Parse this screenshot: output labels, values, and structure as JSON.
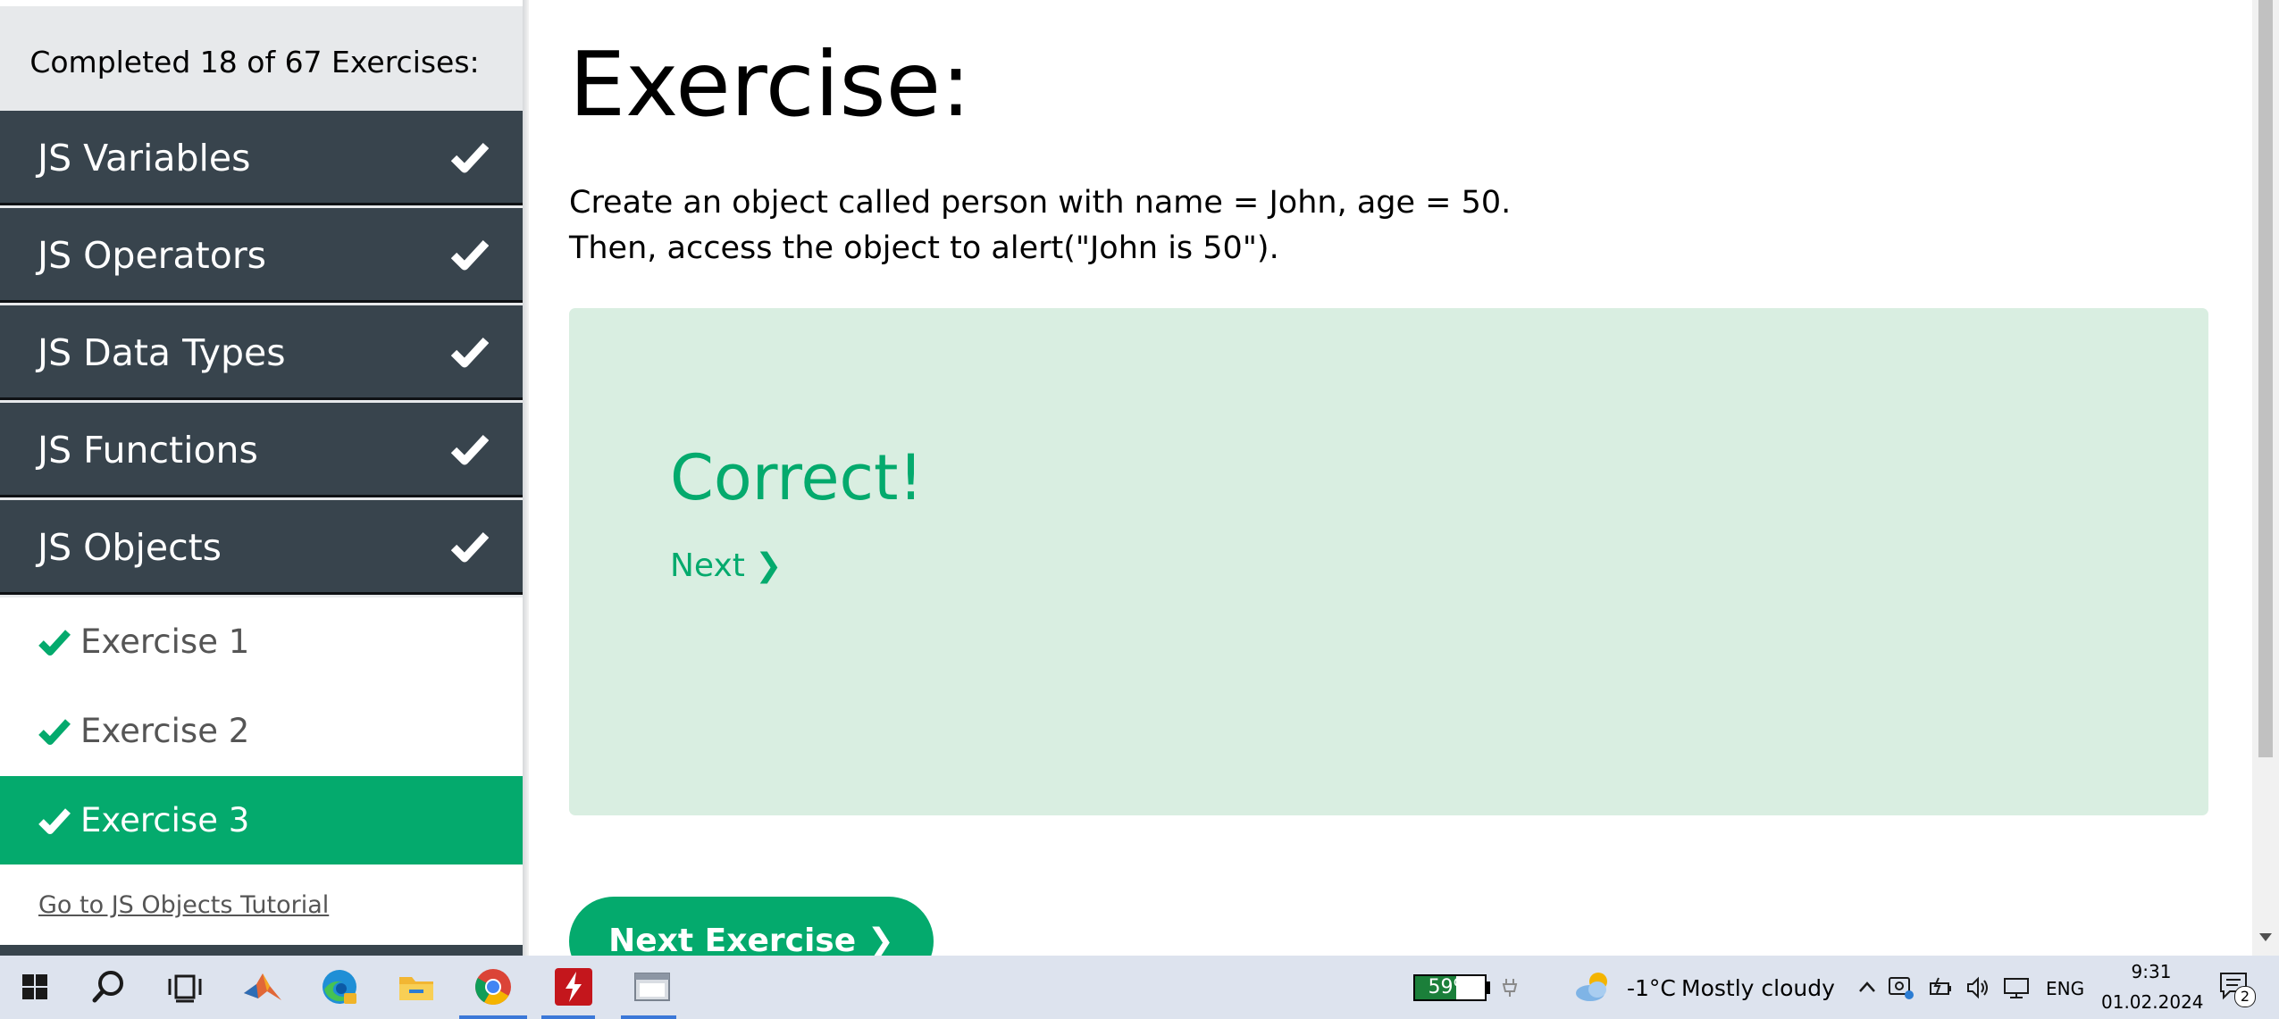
{
  "sidebar": {
    "progress_text": "Completed 18 of 67 Exercises:",
    "categories": [
      {
        "label": "JS Variables"
      },
      {
        "label": "JS Operators"
      },
      {
        "label": "JS Data Types"
      },
      {
        "label": "JS Functions"
      },
      {
        "label": "JS Objects"
      }
    ],
    "exercises": [
      {
        "label": "Exercise 1"
      },
      {
        "label": "Exercise 2"
      },
      {
        "label": "Exercise 3"
      }
    ],
    "tutorial_link": "Go to JS Objects Tutorial"
  },
  "main": {
    "title": "Exercise:",
    "instruction_line1": "Create an object called person with name = John, age = 50.",
    "instruction_line2": "Then, access the object to alert(\"John is 50\").",
    "result_title": "Correct!",
    "result_next": "Next ❯",
    "next_exercise_button": "Next Exercise ❯"
  },
  "taskbar": {
    "battery_percent": "59%",
    "battery_level": 0.59,
    "weather_temp": "-1°C",
    "weather_desc": "Mostly cloudy",
    "language": "ENG",
    "time": "9:31",
    "date": "01.02.2024",
    "notification_count": "2",
    "icons": [
      "windows-start-icon",
      "search-icon",
      "task-view-icon",
      "matlab-icon",
      "edge-icon",
      "file-explorer-icon",
      "chrome-icon",
      "acrobat-icon",
      "app-window-icon"
    ]
  },
  "colors": {
    "accent_green": "#04aa6d",
    "sidebar_dark": "#38444d",
    "result_bg": "#d9eee1"
  }
}
